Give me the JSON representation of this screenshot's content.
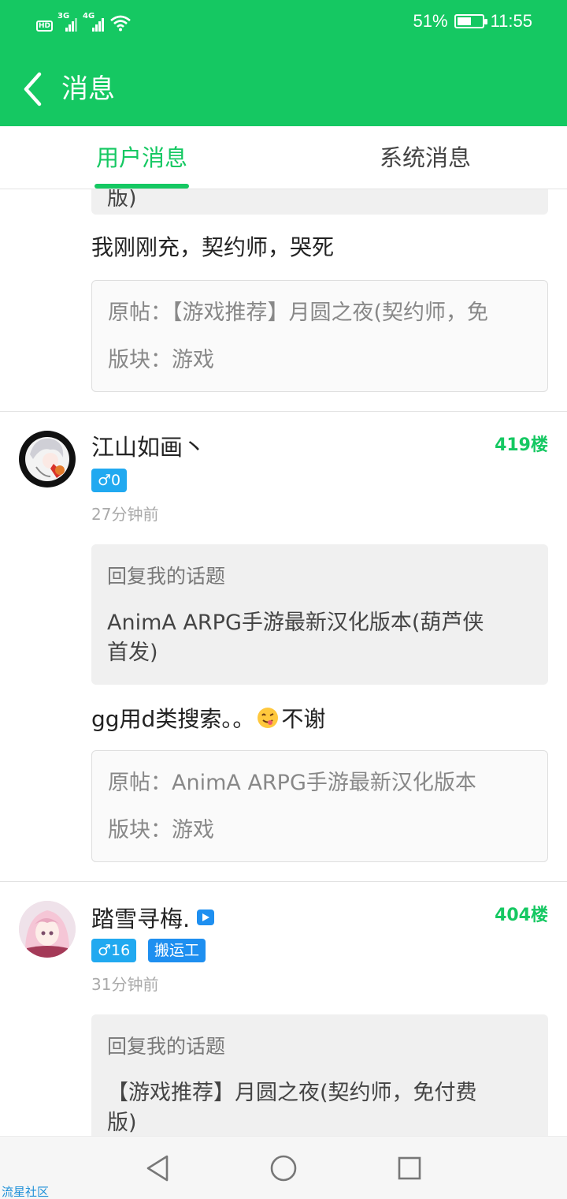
{
  "status_bar": {
    "left_labels": [
      "HD",
      "3G",
      "4G"
    ],
    "battery_percent": "51%",
    "time": "11:55"
  },
  "header": {
    "title": "消息",
    "back_icon": "chevron-left-icon"
  },
  "tabs": [
    {
      "label": "用户消息",
      "active": true
    },
    {
      "label": "系统消息",
      "active": false
    }
  ],
  "top_partial": {
    "quote_tail": "版)",
    "reply_text": "我刚刚充，契约师，哭死",
    "original_post": "原帖：【游戏推荐】月圆之夜(契约师，免",
    "board": "版块：游戏"
  },
  "messages": [
    {
      "username": "江山如画丶",
      "gender_level": "♂0",
      "floor": "419楼",
      "time": "27分钟前",
      "quote_header": "回复我的话题",
      "quote_line1": "AnimA   ARPG手游最新汉化版本(葫芦侠",
      "quote_line2": "首发)",
      "reply_text": "gg用d类搜索。。",
      "reply_text_end": "不谢",
      "original_post": "原帖：AnimA   ARPG手游最新汉化版本",
      "board": "版块：游戏"
    },
    {
      "username": "踏雪寻梅.",
      "gender_level": "♂16",
      "tag": "搬运工",
      "floor": "404楼",
      "time": "31分钟前",
      "quote_header": "回复我的话题",
      "quote_line1": "【游戏推荐】月圆之夜(契约师，免付费",
      "quote_line2": "版)"
    }
  ],
  "watermark": "流星社区",
  "colors": {
    "accent": "#15c862",
    "badge_blue": "#21a9f0",
    "tag_blue": "#1e8ff0"
  }
}
